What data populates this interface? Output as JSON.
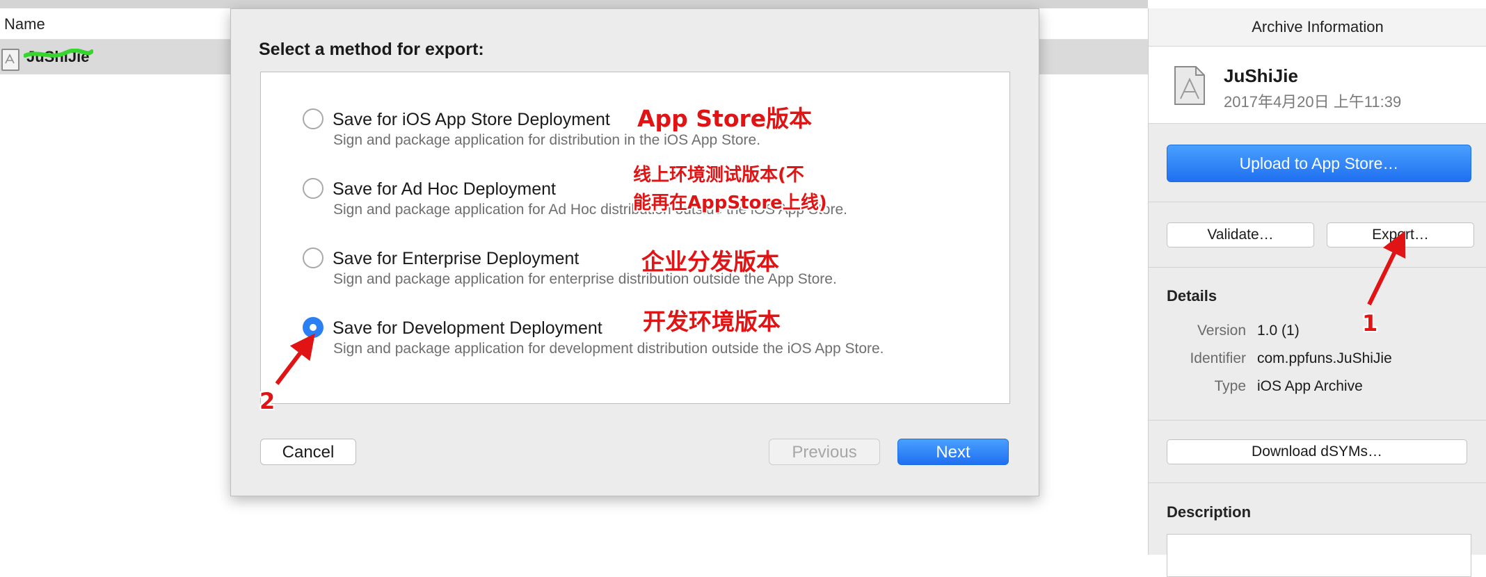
{
  "list": {
    "column_name": "Name",
    "row_name": "JuShiJie"
  },
  "inspector": {
    "title": "Archive Information",
    "archive_name": "JuShiJie",
    "archive_date": "2017年4月20日 上午11:39",
    "upload_button": "Upload to App Store…",
    "validate_button": "Validate…",
    "export_button": "Export…",
    "details_title": "Details",
    "details": [
      {
        "label": "Version",
        "value": "1.0 (1)"
      },
      {
        "label": "Identifier",
        "value": "com.ppfuns.JuShiJie"
      },
      {
        "label": "Type",
        "value": "iOS App Archive"
      }
    ],
    "download_dsyms_button": "Download dSYMs…",
    "description_title": "Description"
  },
  "dialog": {
    "title": "Select a method for export:",
    "options": [
      {
        "title": "Save for iOS App Store Deployment",
        "description": "Sign and package application for distribution in the iOS App Store.",
        "selected": false
      },
      {
        "title": "Save for Ad Hoc Deployment",
        "description": "Sign and package application for Ad Hoc distribution outside the iOS App Store.",
        "selected": false
      },
      {
        "title": "Save for Enterprise Deployment",
        "description": "Sign and package application for enterprise distribution outside the App Store.",
        "selected": false
      },
      {
        "title": "Save for Development Deployment",
        "description": "Sign and package application for development distribution outside the iOS App Store.",
        "selected": true
      }
    ],
    "cancel_button": "Cancel",
    "previous_button": "Previous",
    "next_button": "Next"
  },
  "annotations": {
    "app_store": "App Store版本",
    "ad_hoc_line1": "线上环境测试版本(不",
    "ad_hoc_line2": "能再在AppStore上线)",
    "enterprise": "企业分发版本",
    "development": "开发环境版本",
    "marker_1": "1",
    "marker_2": "2"
  },
  "colors": {
    "accent_blue": "#2b7ff5",
    "annotation_red": "#e01414",
    "selected_row": "#dadada"
  }
}
